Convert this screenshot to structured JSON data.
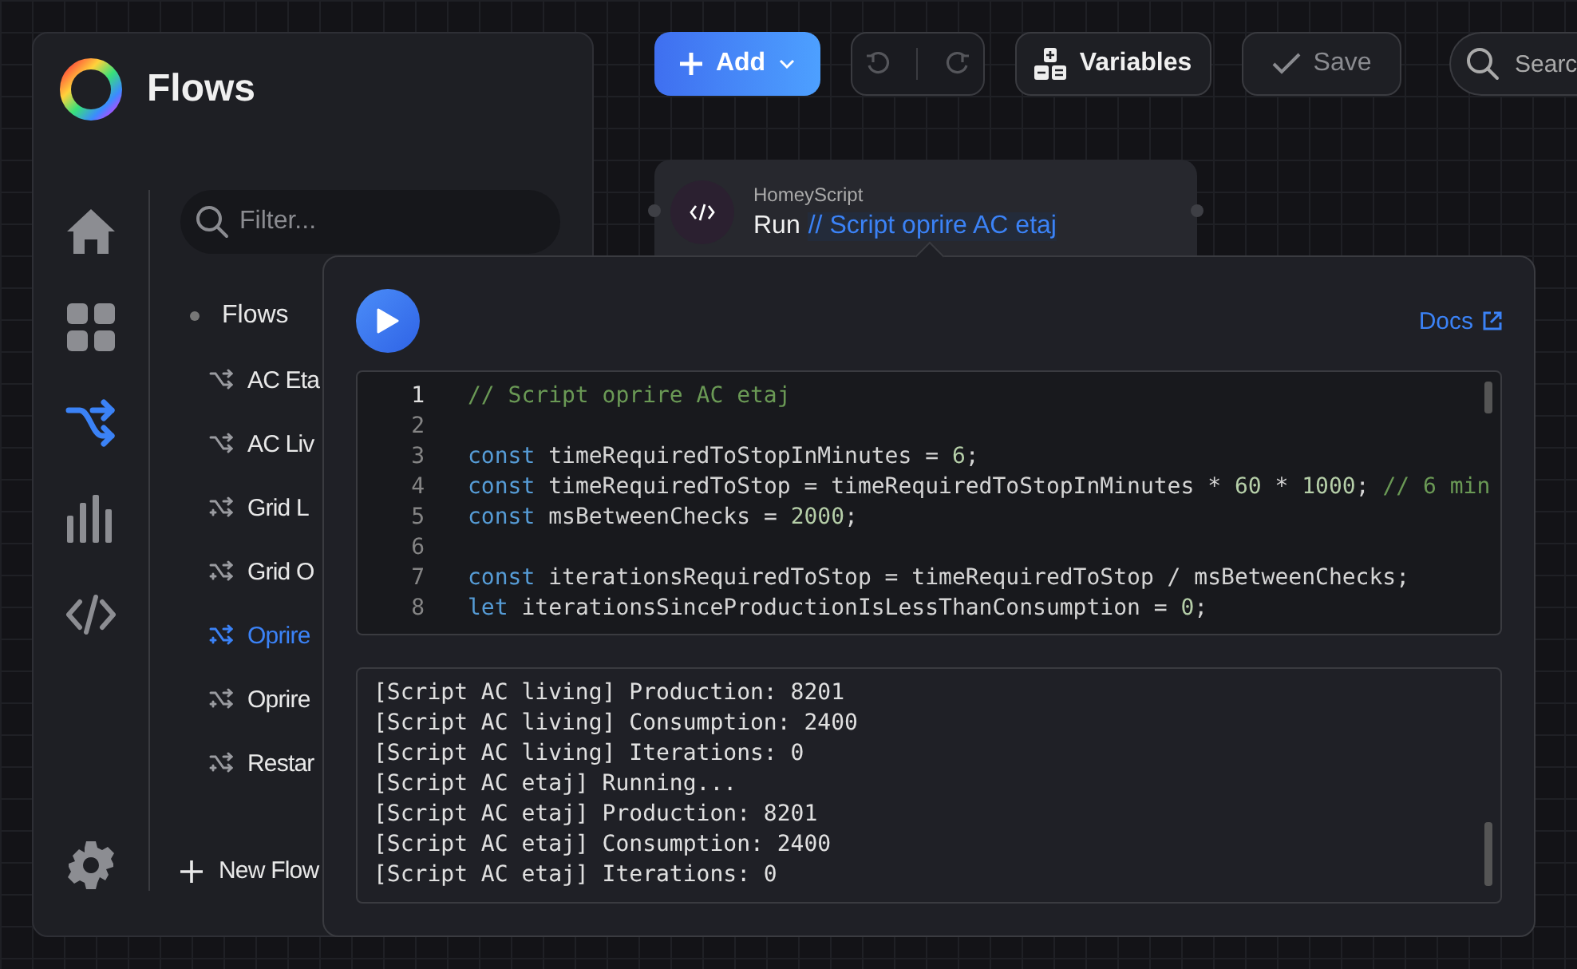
{
  "sidebar": {
    "title": "Flows",
    "nav": [
      {
        "kind": "home",
        "selected": false
      },
      {
        "kind": "dashboard",
        "selected": false
      },
      {
        "kind": "flows",
        "selected": true
      },
      {
        "kind": "insights",
        "selected": false
      },
      {
        "kind": "code",
        "selected": false
      }
    ],
    "filter": {
      "placeholder": "Filter..."
    },
    "folder": "Flows",
    "items": [
      {
        "label": "AC Eta",
        "kind": "branch",
        "selected": false
      },
      {
        "label": "AC Liv",
        "kind": "branch",
        "selected": false
      },
      {
        "label": "Grid L",
        "kind": "shuffle",
        "selected": false
      },
      {
        "label": "Grid O",
        "kind": "shuffle",
        "selected": false
      },
      {
        "label": "Oprire",
        "kind": "shuffle",
        "selected": true
      },
      {
        "label": "Oprire",
        "kind": "shuffle",
        "selected": false
      },
      {
        "label": "Restar",
        "kind": "shuffle",
        "selected": false
      }
    ],
    "new_flow": "New Flow"
  },
  "toolbar": {
    "add": "Add",
    "undo": {
      "disabled": true
    },
    "redo": {
      "disabled": true
    },
    "variables": "Variables",
    "save": {
      "label": "Save",
      "disabled": true
    },
    "search": {
      "placeholder": "Searc"
    }
  },
  "node": {
    "app": "HomeyScript",
    "action": "Run",
    "argument": "// Script oprire AC etaj"
  },
  "editor": {
    "docs": "Docs",
    "lines": [
      {
        "number": "1",
        "active": true,
        "tokens": [
          {
            "kind": "comment",
            "text": "// Script oprire AC etaj"
          }
        ]
      },
      {
        "number": "2",
        "active": false
      },
      {
        "number": "3",
        "active": false,
        "tokens": [
          {
            "kind": "keyword",
            "text": "const"
          },
          {
            "kind": "plain",
            "text": " timeRequiredToStopInMinutes = "
          },
          {
            "kind": "number",
            "text": "6"
          },
          {
            "kind": "plain",
            "text": ";"
          }
        ]
      },
      {
        "number": "4",
        "active": false,
        "tokens": [
          {
            "kind": "keyword",
            "text": "const"
          },
          {
            "kind": "plain",
            "text": " timeRequiredToStop = timeRequiredToStopInMinutes * "
          },
          {
            "kind": "number",
            "text": "60"
          },
          {
            "kind": "plain",
            "text": " * "
          },
          {
            "kind": "number",
            "text": "1000"
          },
          {
            "kind": "plain",
            "text": "; "
          },
          {
            "kind": "comment",
            "text": "// 6 min"
          }
        ]
      },
      {
        "number": "5",
        "active": false,
        "tokens": [
          {
            "kind": "keyword",
            "text": "const"
          },
          {
            "kind": "plain",
            "text": " msBetweenChecks = "
          },
          {
            "kind": "number",
            "text": "2000"
          },
          {
            "kind": "plain",
            "text": ";"
          }
        ]
      },
      {
        "number": "6",
        "active": false
      },
      {
        "number": "7",
        "active": false,
        "tokens": [
          {
            "kind": "keyword",
            "text": "const"
          },
          {
            "kind": "plain",
            "text": " iterationsRequiredToStop = timeRequiredToStop / msBetweenChecks;"
          }
        ]
      },
      {
        "number": "8",
        "active": false,
        "tokens": [
          {
            "kind": "keyword",
            "text": "let"
          },
          {
            "kind": "plain",
            "text": " iterationsSinceProductionIsLessThanConsumption = "
          },
          {
            "kind": "number",
            "text": "0"
          },
          {
            "kind": "plain",
            "text": ";"
          }
        ]
      }
    ],
    "log": [
      "[Script AC living] Production: 8201",
      "[Script AC living] Consumption: 2400",
      "[Script AC living] Iterations: 0",
      "[Script AC etaj] Running...",
      "[Script AC etaj] Production: 8201",
      "[Script AC etaj] Consumption: 2400",
      "[Script AC etaj] Iterations: 0"
    ]
  }
}
